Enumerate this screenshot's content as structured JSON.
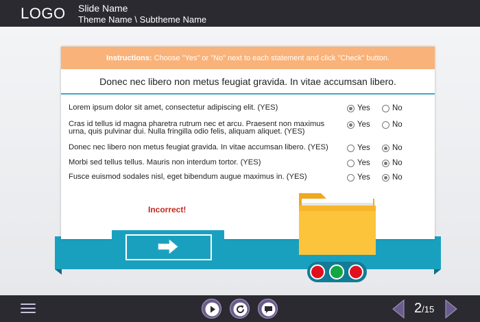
{
  "header": {
    "logo": "LOGO",
    "slide_name": "Slide Name",
    "theme_name": "Theme Name \\ Subtheme Name"
  },
  "instructions": {
    "label": "Instructions:",
    "text": " Choose \"Yes\" or \"No\" next to each statement and click \"Check\" button."
  },
  "question": "Donec nec libero non metus feugiat gravida. In vitae accumsan libero.",
  "options": {
    "yes": "Yes",
    "no": "No"
  },
  "statements": [
    {
      "text": "Lorem ipsum dolor sit amet, consectetur adipiscing elit. (YES)",
      "selected": "yes"
    },
    {
      "text": "Cras id tellus id magna pharetra rutrum nec et arcu. Praesent non maximus urna, quis pulvinar dui. Nulla fringilla odio felis, aliquam aliquet. (YES)",
      "selected": "yes"
    },
    {
      "text": "Donec nec libero non metus feugiat gravida. In vitae accumsan libero. (YES)",
      "selected": "no"
    },
    {
      "text": "Morbi sed tellus tellus. Mauris non interdum tortor. (YES)",
      "selected": "no"
    },
    {
      "text": "Fusce euismod sodales nisl, eget bibendum augue maximus in. (YES)",
      "selected": "no"
    }
  ],
  "feedback": "Incorrect!",
  "check_button": {
    "icon": "arrow-right-icon"
  },
  "progress_dots": [
    "#e0101e",
    "#13a644",
    "#e0101e"
  ],
  "footer": {
    "page_current": "2",
    "page_total": "/15"
  },
  "colors": {
    "accent": "#1aa0bf",
    "bar": "#2b2a31",
    "instructions_bg": "#f9b279",
    "control": "#6b5c8d",
    "incorrect": "#c0271c"
  }
}
